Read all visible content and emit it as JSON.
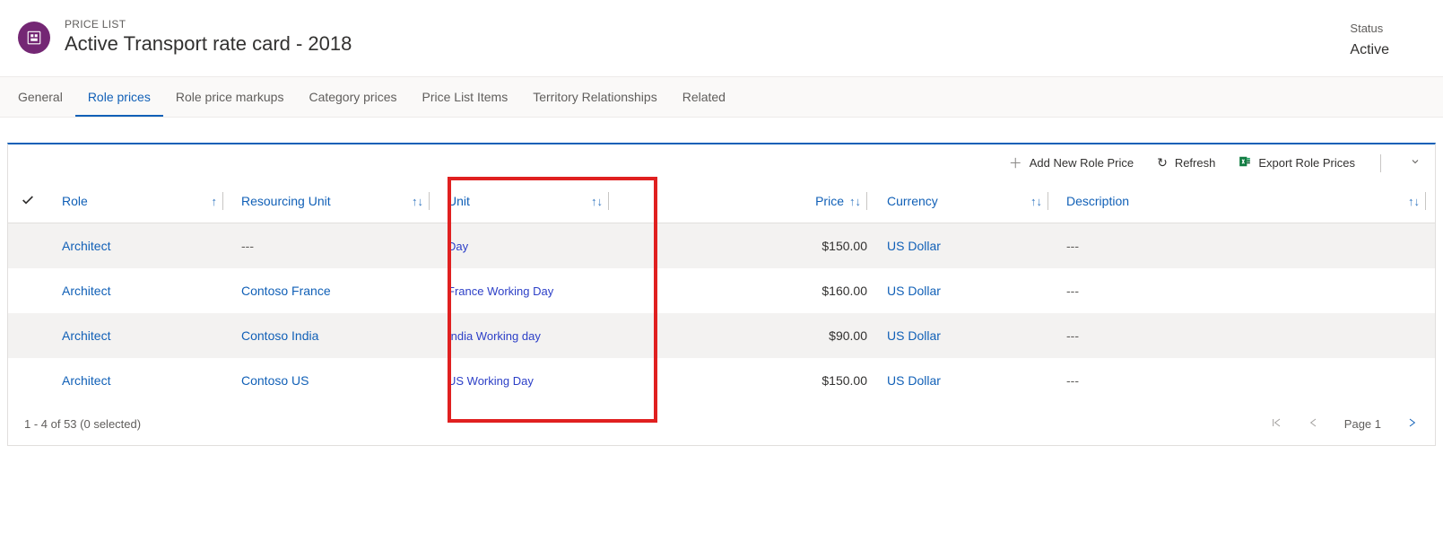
{
  "header": {
    "eyebrow": "PRICE LIST",
    "title": "Active Transport rate card - 2018",
    "status_label": "Status",
    "status_value": "Active"
  },
  "tabs": [
    {
      "label": "General",
      "active": false
    },
    {
      "label": "Role prices",
      "active": true
    },
    {
      "label": "Role price markups",
      "active": false
    },
    {
      "label": "Category prices",
      "active": false
    },
    {
      "label": "Price List Items",
      "active": false
    },
    {
      "label": "Territory Relationships",
      "active": false
    },
    {
      "label": "Related",
      "active": false
    }
  ],
  "toolbar": {
    "add": "Add New Role Price",
    "refresh": "Refresh",
    "export": "Export Role Prices"
  },
  "columns": {
    "role": "Role",
    "resourcing_unit": "Resourcing Unit",
    "unit": "Unit",
    "price": "Price",
    "currency": "Currency",
    "description": "Description"
  },
  "rows": [
    {
      "role": "Architect",
      "resourcing_unit": "---",
      "unit": "Day",
      "price": "$150.00",
      "currency": "US Dollar",
      "description": "---"
    },
    {
      "role": "Architect",
      "resourcing_unit": "Contoso France",
      "unit": "France Working Day",
      "price": "$160.00",
      "currency": "US Dollar",
      "description": "---"
    },
    {
      "role": "Architect",
      "resourcing_unit": "Contoso India",
      "unit": "India Working day",
      "price": "$90.00",
      "currency": "US Dollar",
      "description": "---"
    },
    {
      "role": "Architect",
      "resourcing_unit": "Contoso US",
      "unit": "US Working Day",
      "price": "$150.00",
      "currency": "US Dollar",
      "description": "---"
    }
  ],
  "footer": {
    "range": "1 - 4 of 53 (0 selected)",
    "page_label": "Page 1"
  }
}
